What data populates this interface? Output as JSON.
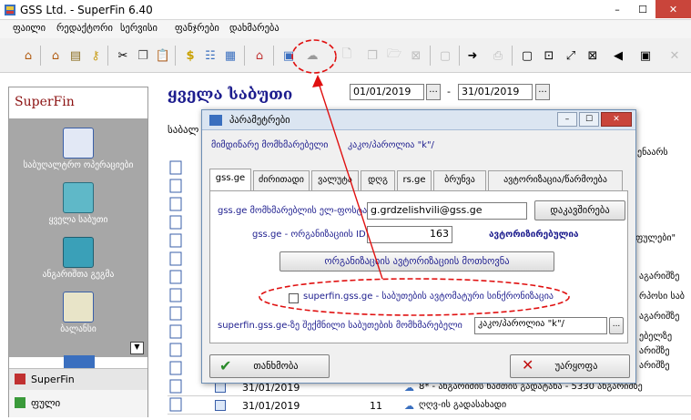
{
  "window": {
    "title": "GSS Ltd. - SuperFin 6.40",
    "minimize": "–",
    "maximize": "☐",
    "close": "✕"
  },
  "menu": [
    "ფაილი",
    "რედაქტორი",
    "სერვისი",
    "ფანჯრები",
    "დახმარება"
  ],
  "left_panel": {
    "header": "SuperFin",
    "items": [
      "საბუღალტრო ოპერაციები",
      "ყველა საბუთი",
      "ანგარიშთა გეგმა",
      "ბალანსი"
    ],
    "footer_items": [
      "SuperFin",
      "ფული"
    ]
  },
  "main": {
    "title": "ყველა საბუთი",
    "date_from": "01/01/2019",
    "date_to": "31/01/2019",
    "dots": "...",
    "dash": "-",
    "col_header": "საბალ",
    "right_col_header": "ენაარს",
    "rows": [
      {
        "date": "31/01/2019",
        "num": "",
        "desc": "8* - ანგარიშის ნაშთის გადატანა - 5330 ანგარიშზე"
      },
      {
        "date": "31/01/2019",
        "num": "11",
        "desc": "ღღვ-ის გადასახადი"
      }
    ],
    "right_snippets": [
      "ფულები\"",
      "აგარიშზე",
      "რპოსი საბ",
      "აგარიშზე",
      "ებელზე",
      "არიშზე",
      "არიშზე",
      "აფარიშზე",
      "არიშზე"
    ]
  },
  "dialog": {
    "title": "პარამეტრები",
    "current_user_label": "მიმდინარე მომხმარებელი",
    "current_user": "კაკო/პაროლია \"k\"/",
    "tabs": [
      "gss.ge",
      "ძირითადი",
      "ვალუტა",
      "დღგ",
      "rs.ge",
      "ბრუნვა",
      "ავტორიზაცია",
      "წარმოება"
    ],
    "active_tab": "gss.ge",
    "email_label": "gss.ge მომხმარებლის ელ-ფოსტა:",
    "email_value": "g.grdzelishvili@gss.ge",
    "connect_button": "დაკავშირება",
    "org_id_label": "gss.ge - ორგანიზაციის ID:",
    "org_id_value": "163",
    "authorized_text": "ავტორიზირებულია",
    "auth_org_button": "ორგანიზაციის ავტორიზაციის მოთხოვნა",
    "sync_checkbox_label": "superfin.gss.ge - საბუთების ავტომატური სინქრონიზაცია",
    "sync_checked": false,
    "user_label": "superfin.gss.ge-ზე შექმნილი საბუთების მომხმარებელი",
    "user_value": "კაკო/პაროლია \"k\"/",
    "ok_button": "თანხმობა",
    "cancel_button": "უარყოფა"
  },
  "colors": {
    "accent": "#1d1d8e",
    "brand_red": "#8b1010",
    "annotation_red": "#e01010"
  }
}
